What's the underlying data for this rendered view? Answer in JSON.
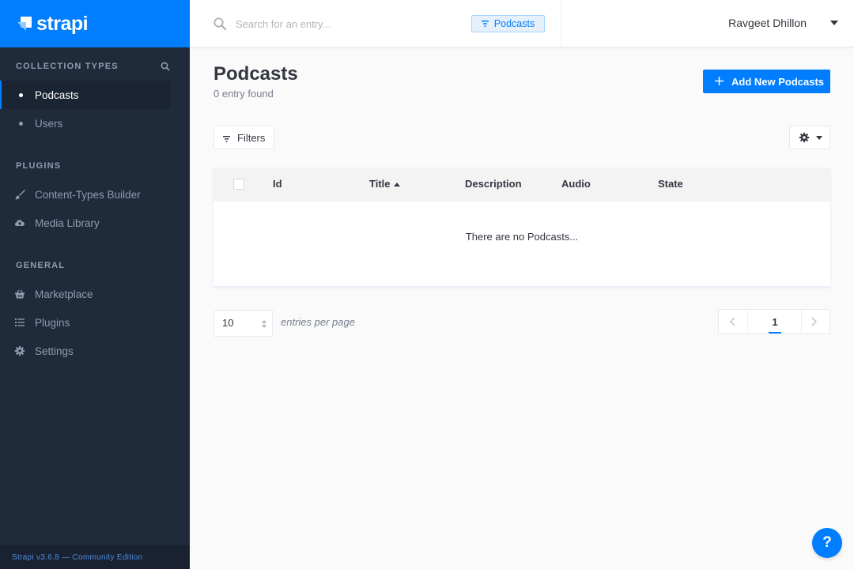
{
  "sidebar": {
    "brand": "strapi",
    "sections": [
      {
        "title": "COLLECTION TYPES"
      },
      {
        "title": "PLUGINS"
      },
      {
        "title": "GENERAL"
      }
    ],
    "collection_items": [
      {
        "label": "Podcasts",
        "active": true
      },
      {
        "label": "Users",
        "active": false
      }
    ],
    "plugin_items": [
      {
        "label": "Content-Types Builder",
        "icon": "paint-brush-icon"
      },
      {
        "label": "Media Library",
        "icon": "cloud-upload-icon"
      }
    ],
    "general_items": [
      {
        "label": "Marketplace",
        "icon": "shopping-basket-icon"
      },
      {
        "label": "Plugins",
        "icon": "list-icon"
      },
      {
        "label": "Settings",
        "icon": "gear-icon"
      }
    ],
    "footer": "Strapi v3.6.8 — Community Edition"
  },
  "header": {
    "search_placeholder": "Search for an entry...",
    "search_tag": "Podcasts",
    "user_name": "Ravgeet Dhillon"
  },
  "main": {
    "title": "Podcasts",
    "subtitle": "0 entry found",
    "add_button": "Add New Podcasts",
    "filters_button": "Filters",
    "table": {
      "columns": [
        "Id",
        "Title",
        "Description",
        "Audio",
        "State"
      ],
      "sorted_column": "Title",
      "sort_direction": "asc",
      "empty_message": "There are no Podcasts..."
    },
    "per_page": {
      "value": "10",
      "label": "entries per page"
    },
    "pagination": {
      "current_page": "1"
    }
  },
  "help_button": "?",
  "colors": {
    "accent": "#007eff",
    "sidebar_bg": "#1f2a3b",
    "page_bg": "#fafafb"
  }
}
